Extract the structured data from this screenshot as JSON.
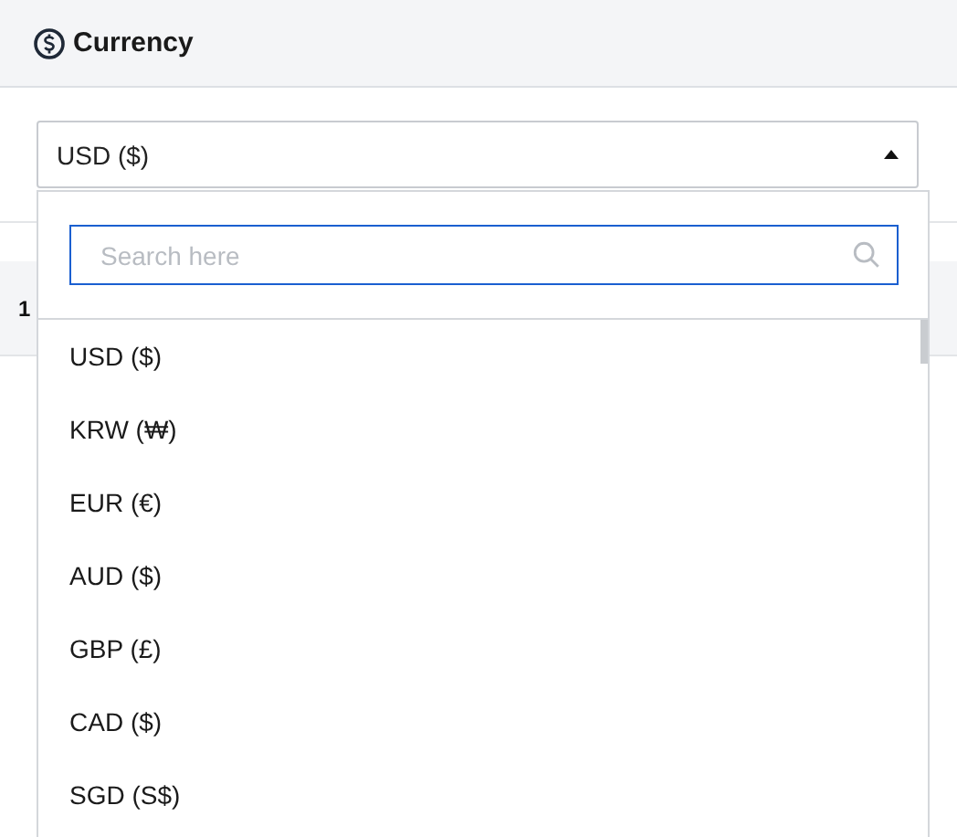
{
  "header": {
    "title": "Currency"
  },
  "select": {
    "value": "USD ($)",
    "expanded": true
  },
  "background_row": {
    "text": "1"
  },
  "dropdown": {
    "search": {
      "placeholder": "Search here"
    },
    "options": [
      {
        "label": "USD ($)"
      },
      {
        "label": "KRW (₩)"
      },
      {
        "label": "EUR (€)"
      },
      {
        "label": "AUD ($)"
      },
      {
        "label": "GBP (£)"
      },
      {
        "label": "CAD ($)"
      },
      {
        "label": "SGD (S$)"
      }
    ]
  }
}
